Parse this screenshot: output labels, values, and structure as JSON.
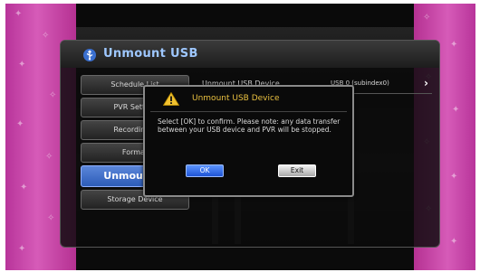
{
  "panel": {
    "title": "Unmount USB"
  },
  "menu": {
    "items": [
      {
        "label": "Schedule List"
      },
      {
        "label": "PVR Setting"
      },
      {
        "label": "Recording F"
      },
      {
        "label": "Format"
      },
      {
        "label": "Unmount U",
        "selected": true
      },
      {
        "label": "Storage Device"
      }
    ]
  },
  "content": {
    "row_label": "Unmount USB Device",
    "row_value": "USB 0 (subindex0)",
    "row_arrow": "›"
  },
  "dialog": {
    "title": "Unmount USB Device",
    "message": "Select [OK] to confirm. Please note: any data transfer between your USB device and PVR will be stopped.",
    "ok_label": "OK",
    "exit_label": "Exit"
  },
  "colors": {
    "accent_blue": "#2c5cb8",
    "title_blue": "#9ec7ff",
    "warning_yellow": "#e9c040",
    "side_pink": "#c8449f"
  },
  "icons": {
    "header": "usb-icon",
    "dialog": "warning-icon",
    "side": "swirl-icon"
  }
}
